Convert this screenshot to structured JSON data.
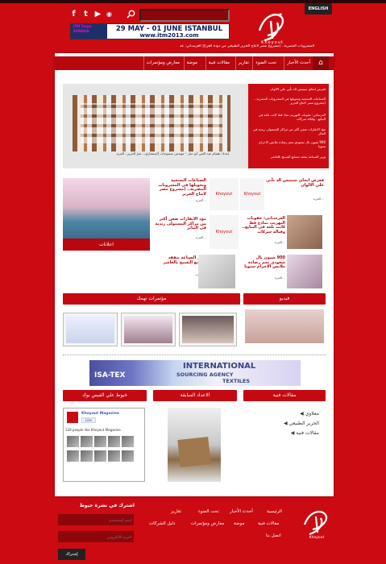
{
  "header": {
    "lang_button": "ENGLISH",
    "logo_text": "Khoyout",
    "banner": {
      "brand": "ITM Texpo",
      "brand_sub": "EURASIA",
      "dates": "29 MAY - 01 JUNE ISTANBUL",
      "url": "www.itm2013.com"
    },
    "ticker": "المشروبات المصرية.. (مشروع مصر لانتاج الحرير الطبيعي من دودة القز)|| العرسـاني: عد"
  },
  "nav": {
    "home_icon": "home-icon",
    "items": [
      "أحدث الأخبار",
      "تحت الضوء",
      "تقارير",
      "مقالات فنية",
      "موضة",
      "معارض ومؤتمرات"
    ]
  },
  "slider": {
    "caption": "إعداد: هشام عبد الغني أبو جبل – مهندس منسوجات (استشاري... سرّ الحرير.. العزيد",
    "items": [
      "فعرض ابحاي سيتيس الذ تأتي علي الالوان",
      "الصناعات النسجية وتحويلها في المشروبات المصرية... (مشروع مصر لانتاج الحرير",
      "العرساني: عقوبات التهريب نماذ فط كانت تلغه في البنايع.. وقبالة سركات",
      "مؤذ الاتفارات صعن أكثر من مراكز المستولى ريدية في المائر",
      "900 شيون نال سعودي تحم رضاذة ملابس الاحرام سنويا",
      "وزير الصناعة يتفقد مصانع النسيح بالعاشر"
    ]
  },
  "grid": {
    "col_right": [
      {
        "title": "فعرض ابحاي سيتيس الذ تأتي علي الالوان",
        "body": "...العزيد"
      },
      {
        "title": "العرسـاني: عقوبات التهريب نماذج فط كانت تلغه في البنايع.. وقبالة سركات",
        "body": "...العزيد"
      },
      {
        "title": "900 شيون نال سعودي تحم رضاذة ملابس الاحرام سنويا",
        "body": "...العزيد"
      }
    ],
    "col_mid": [
      {
        "title": "الصناعات النسجية وتحويلها في المشروبات المصرية.. (مشروع مصر لانتاج الحرير",
        "body": "...العزيد"
      },
      {
        "title": "مؤذ الاتفارات صعن أكثر من مراكز المستولى ريدية في المائر",
        "body": "...العزيد"
      },
      {
        "title": "وزير الصناعة يتفقد مصانع النسيح بالعاشر",
        "body": "...العزيد"
      }
    ],
    "khoyout_label": "Khoyout",
    "ads_label": "اعلانات"
  },
  "sections": {
    "events_title": "مؤتمرات تهمك",
    "video_title": "فيديو",
    "categories_title": "مقالات فنية",
    "issue_title": "الاعداد السابقة",
    "facebook_title": "خيوط علي الفيس بوك",
    "categories": [
      "معلاوي",
      "الحرير الطبيعي",
      "مقالات فنية"
    ]
  },
  "ad": {
    "left": "ISA-TEX",
    "line1": "INTERNATIONAL",
    "line2": "SOURCING AGENCY",
    "line3": "TEXTILES"
  },
  "facebook": {
    "page_name": "Khoyout Magazine",
    "like_label": "Like",
    "count_text": "128 people like Khoyout Magazine."
  },
  "footer": {
    "links": [
      "الرئيسية",
      "أحدث الأخبار",
      "تحت الضوء",
      "تقارير",
      "مقالات فنية",
      "موضة",
      "معارض ومؤتمرات",
      "دليل الشركات",
      "اتصل بنا"
    ],
    "newsletter_title": "اشترك في نشرة خيوط",
    "name_placeholder": "اسم المستخدم",
    "email_placeholder": "البريد الالكتروني",
    "submit_label": "إشتراك"
  },
  "colors": {
    "brand_red": "#cc0a12",
    "dark_red": "#8e050a"
  }
}
